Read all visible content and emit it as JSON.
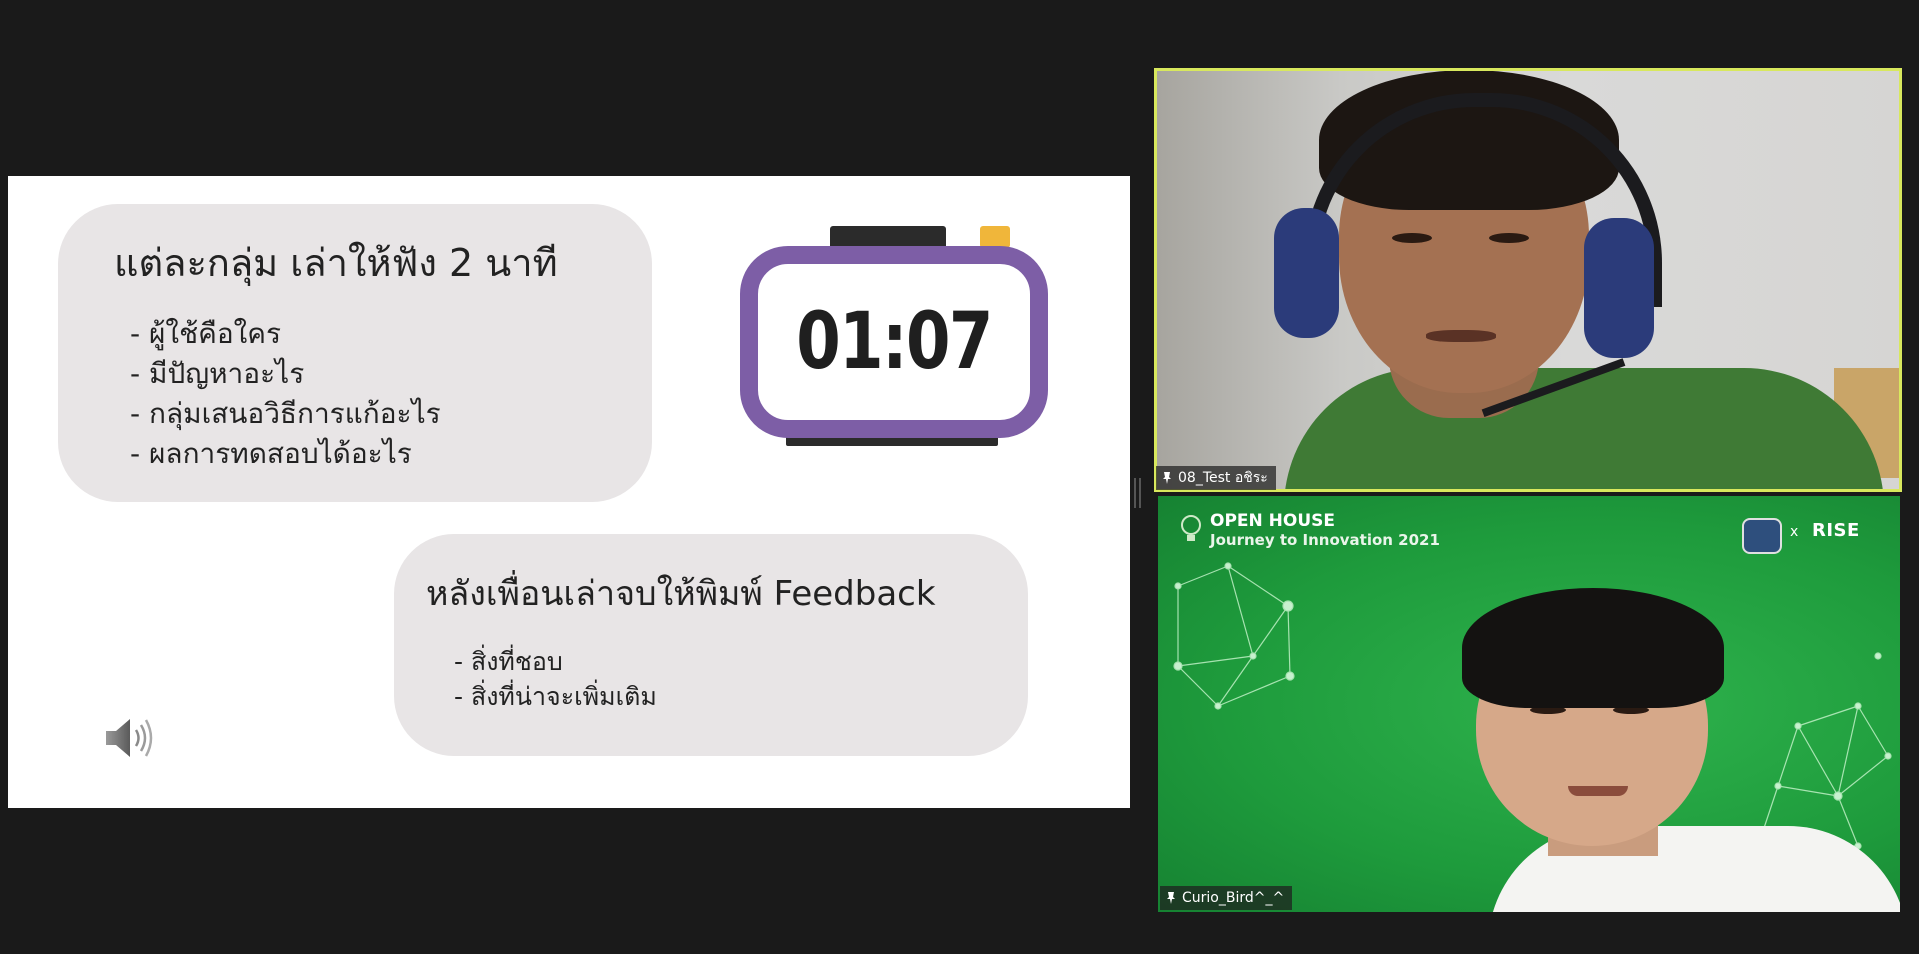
{
  "slide": {
    "card1": {
      "title": "แต่ละกลุ่ม เล่าให้ฟัง 2 นาที",
      "items": [
        "- ผู้ใช้คือใคร",
        "- มีปัญหาอะไร",
        "- กลุ่มเสนอวิธีการแก้อะไร",
        "- ผลการทดสอบได้อะไร"
      ]
    },
    "timer": {
      "value": "01:07",
      "accent": "#7d5ea6"
    },
    "card2": {
      "title": "หลังเพื่อนเล่าจบให้พิมพ์ Feedback",
      "items": [
        "- สิ่งที่ชอบ",
        "- สิ่งที่น่าจะเพิ่มเติม"
      ]
    },
    "audio_icon": "speaker-icon"
  },
  "participants": [
    {
      "name": "08_Test อชิระ",
      "pinned": true,
      "active_speaker": true,
      "highlight_color": "#d8e85d"
    },
    {
      "name": "Curio_Bird^_^",
      "pinned": true,
      "background": {
        "title": "OPEN HOUSE",
        "subtitle": "Journey to Innovation 2021",
        "separator": "x",
        "partner": "RISE"
      }
    }
  ]
}
